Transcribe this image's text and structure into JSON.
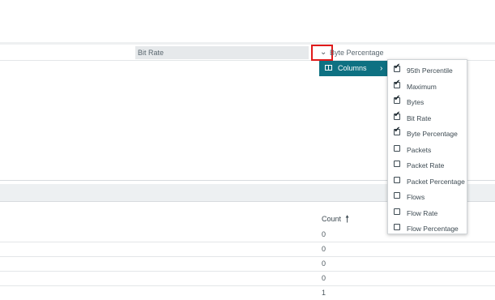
{
  "header": {
    "bit_rate_label": "Bit Rate",
    "byte_percentage_label": "Byte Percentage",
    "menu_chevron": "⌄"
  },
  "menu": {
    "columns_label": "Columns",
    "submenu_arrow": "›",
    "check_mark": "✔",
    "options": [
      {
        "label": "95th Percentile",
        "checked": true
      },
      {
        "label": "Maximum",
        "checked": true
      },
      {
        "label": "Bytes",
        "checked": true
      },
      {
        "label": "Bit Rate",
        "checked": true
      },
      {
        "label": "Byte Percentage",
        "checked": true
      },
      {
        "label": "Packets",
        "checked": false
      },
      {
        "label": "Packet Rate",
        "checked": false
      },
      {
        "label": "Packet Percentage",
        "checked": false
      },
      {
        "label": "Flows",
        "checked": false
      },
      {
        "label": "Flow Rate",
        "checked": false
      },
      {
        "label": "Flow Percentage",
        "checked": false
      }
    ]
  },
  "lower_table": {
    "count_header": "Count",
    "sort_arrow": "🠕",
    "rows": [
      "0",
      "0",
      "0",
      "0",
      "1"
    ]
  },
  "colors": {
    "accent": "#0e7182",
    "highlight_box": "#e01b1b"
  }
}
